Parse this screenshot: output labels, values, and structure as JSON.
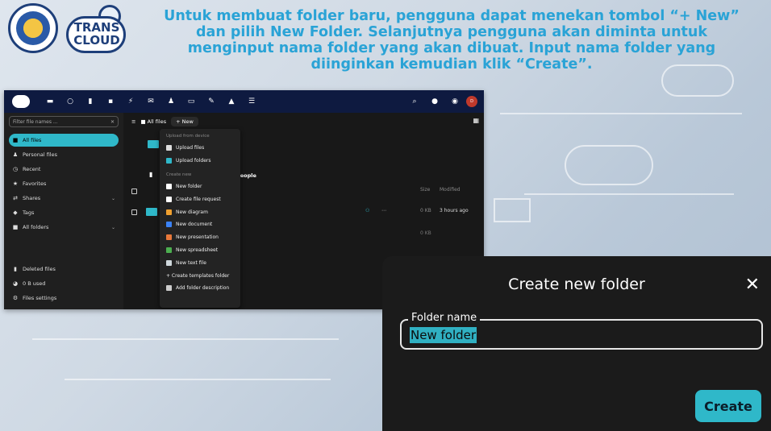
{
  "header": {
    "logo1_alt": "institution-seal",
    "logo2_text": "TRANS CLOUD",
    "headline": "Untuk membuat folder baru, pengguna dapat menekan tombol “+ New” dan pilih New Folder. Selanjutnya pengguna akan diminta untuk menginput nama folder yang akan dibuat. Input nama folder yang diinginkan kemudian klik “Create”."
  },
  "app": {
    "filter_placeholder": "Filter file names ...",
    "sidebar": {
      "items": [
        {
          "label": "All files",
          "icon": "folder-icon",
          "active": true
        },
        {
          "label": "Personal files",
          "icon": "user-icon"
        },
        {
          "label": "Recent",
          "icon": "clock-icon"
        },
        {
          "label": "Favorites",
          "icon": "star-icon"
        },
        {
          "label": "Shares",
          "icon": "share-icon",
          "chevron": true
        },
        {
          "label": "Tags",
          "icon": "tag-icon"
        },
        {
          "label": "All folders",
          "icon": "folder-icon",
          "chevron": true
        }
      ],
      "bottom": [
        {
          "label": "Deleted files",
          "icon": "trash-icon"
        },
        {
          "label": "0 B used",
          "icon": "pie-icon"
        },
        {
          "label": "Files settings",
          "icon": "gear-icon"
        }
      ]
    },
    "breadcrumb": "All files",
    "new_button": "+ New",
    "people_label": "People",
    "columns": {
      "size": "Size",
      "modified": "Modified"
    },
    "row": {
      "size": "0 KB",
      "modified": "3 hours ago"
    },
    "row2_size": "0 KB",
    "menu": {
      "upload_header": "Upload from device",
      "upload_items": [
        "Upload files",
        "Upload folders"
      ],
      "create_header": "Create new",
      "create_items": [
        {
          "label": "New folder",
          "color": "#ffffff"
        },
        {
          "label": "Create file request",
          "color": "#ffffff"
        },
        {
          "label": "New diagram",
          "color": "#f0a030"
        },
        {
          "label": "New document",
          "color": "#3b82f6"
        },
        {
          "label": "New presentation",
          "color": "#e8783a"
        },
        {
          "label": "New spreadsheet",
          "color": "#4caf50"
        },
        {
          "label": "New text file",
          "color": "#cfd8dc"
        },
        {
          "label": "+ Create templates folder",
          "color": "#cccccc"
        },
        {
          "label": "Add folder description",
          "color": "#cccccc"
        }
      ]
    }
  },
  "dialog": {
    "title": "Create new folder",
    "field_label": "Folder name",
    "field_value": "New folder",
    "create_label": "Create"
  }
}
